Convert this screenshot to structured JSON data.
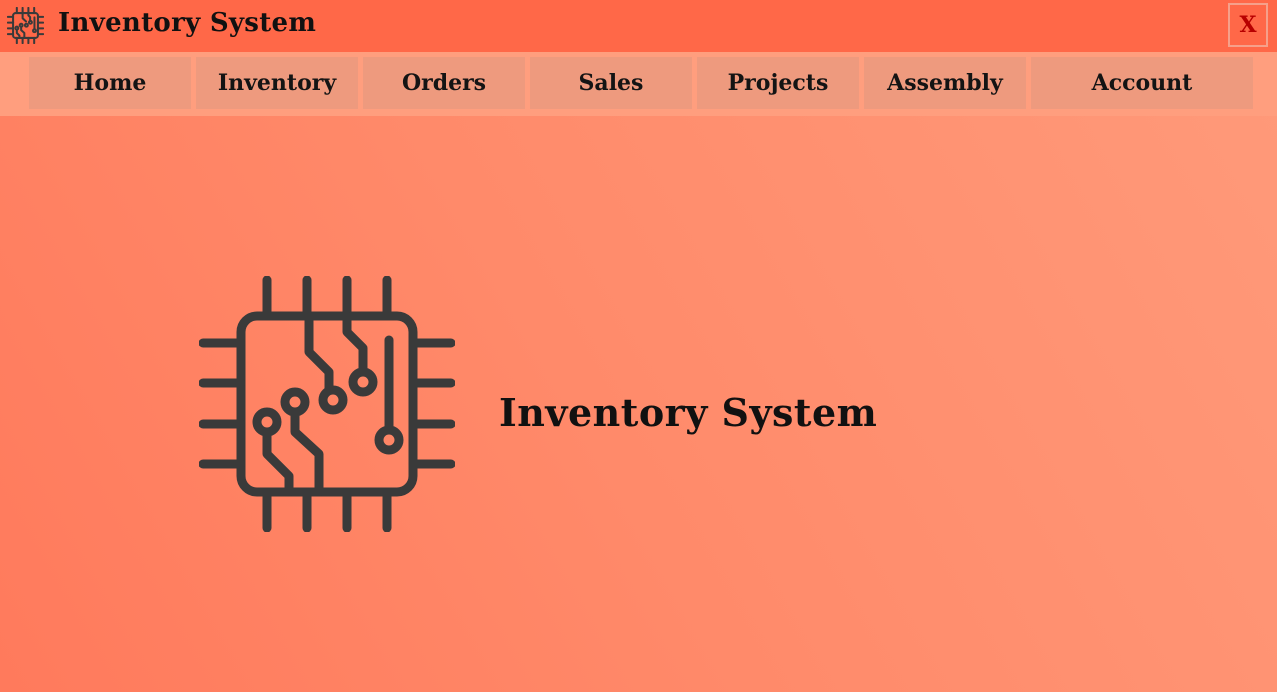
{
  "window": {
    "title": "Inventory System",
    "close_label": "X",
    "app_icon": "circuit-chip-icon"
  },
  "nav": {
    "items": [
      {
        "label": "Home"
      },
      {
        "label": "Inventory"
      },
      {
        "label": "Orders"
      },
      {
        "label": "Sales"
      },
      {
        "label": "Projects"
      },
      {
        "label": "Assembly"
      },
      {
        "label": "Account"
      }
    ]
  },
  "hero": {
    "title": "Inventory System",
    "icon": "circuit-chip-icon"
  },
  "colors": {
    "titlebar": "#ff6848",
    "navbar": "#ff9e7e",
    "nav_button": "#ee9a7e",
    "close_text": "#b80000",
    "icon_stroke": "#3a3a3a"
  }
}
